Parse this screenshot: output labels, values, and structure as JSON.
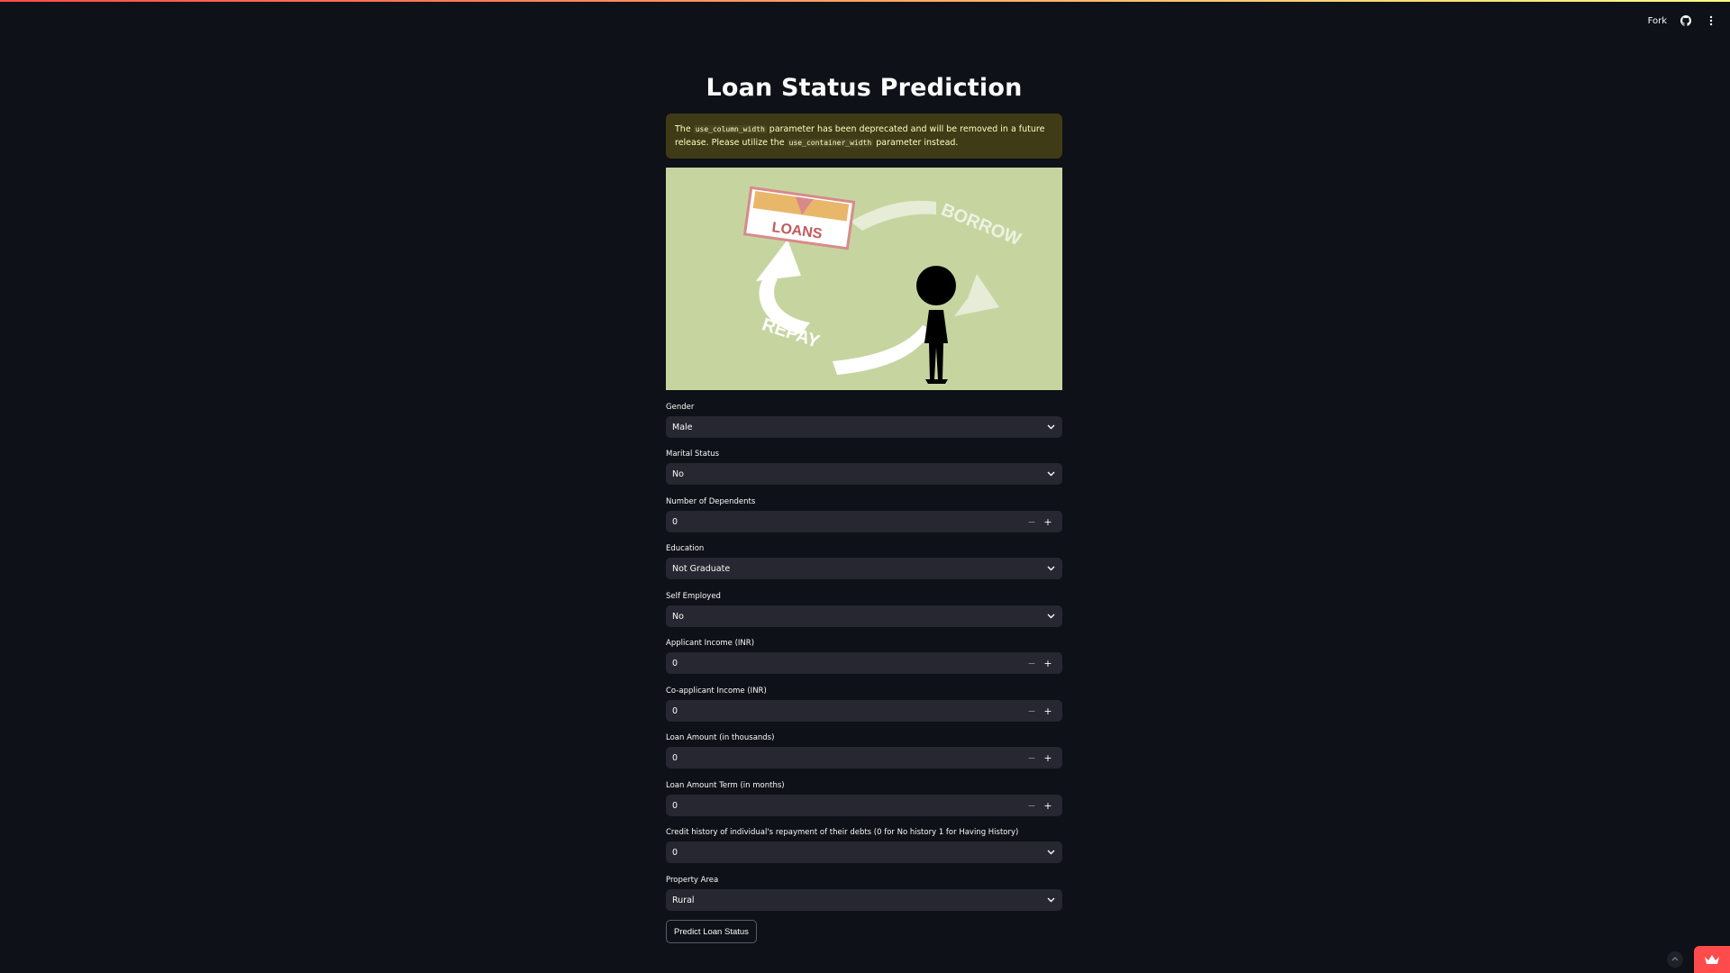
{
  "header": {
    "fork_label": "Fork",
    "github_icon": "github-icon",
    "menu_icon": "kebab-menu-icon"
  },
  "page": {
    "title": "Loan Status Prediction"
  },
  "warning": {
    "text_1": "The",
    "code_1": "use_column_width",
    "text_2": "parameter has been deprecated and will be removed in a future release. Please utilize the",
    "code_2": "use_container_width",
    "text_3": "parameter instead."
  },
  "hero": {
    "sign_text": "LOANS",
    "borrow_text": "BORROW",
    "repay_text": "REPAY"
  },
  "form": {
    "gender": {
      "label": "Gender",
      "value": "Male"
    },
    "marital": {
      "label": "Marital Status",
      "value": "No"
    },
    "dependents": {
      "label": "Number of Dependents",
      "value": "0"
    },
    "education": {
      "label": "Education",
      "value": "Not Graduate"
    },
    "self_employed": {
      "label": "Self Employed",
      "value": "No"
    },
    "app_income": {
      "label": "Applicant Income (INR)",
      "value": "0"
    },
    "coapp_income": {
      "label": "Co-applicant Income (INR)",
      "value": "0"
    },
    "loan_amount": {
      "label": "Loan Amount (in thousands)",
      "value": "0"
    },
    "loan_term": {
      "label": "Loan Amount Term (in months)",
      "value": "0"
    },
    "credit_history": {
      "label": "Credit history of individual's repayment of their debts (0 for No history 1 for Having History)",
      "value": "0"
    },
    "property_area": {
      "label": "Property Area",
      "value": "Rural"
    },
    "predict_button": "Predict Loan Status"
  },
  "stepper": {
    "minus": "−",
    "plus": "+"
  },
  "colors": {
    "background": "#0e1117",
    "control": "#262730",
    "warning_bg": "#3e3b16",
    "accent": "#ff4b4b"
  }
}
